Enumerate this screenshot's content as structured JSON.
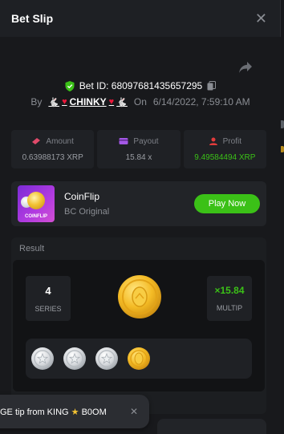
{
  "modal": {
    "title": "Bet Slip",
    "close_symbol": "✕"
  },
  "bet": {
    "id_label": "Bet ID: 68097681435657295",
    "by_label": "By",
    "user_name": "CHINKY",
    "on_label": "On",
    "datetime": "6/14/2022, 7:59:10 AM"
  },
  "stats": [
    {
      "label": "Amount",
      "value": "0.63988173 XRP",
      "icon": "amount-icon",
      "color": "#e04a6a"
    },
    {
      "label": "Payout",
      "value": "15.84 x",
      "icon": "payout-icon",
      "color": "#a458e6"
    },
    {
      "label": "Profit",
      "value": "9.49584494 XRP",
      "icon": "profit-icon",
      "color": "#e23c3c"
    }
  ],
  "game": {
    "name": "CoinFlip",
    "subtitle": "BC Original",
    "thumb_text": "COINFLIP",
    "play_label": "Play Now"
  },
  "result": {
    "title": "Result",
    "series_value": "4",
    "series_label": "SERIES",
    "multiplier_value": "×15.84",
    "multiplier_label": "MULTIP",
    "coins": [
      "silver",
      "silver",
      "silver",
      "gold"
    ]
  },
  "toast": {
    "text_before": "GE tip from KING",
    "star": "★",
    "text_after": "B0OM",
    "close_symbol": "✕"
  },
  "colors": {
    "accent_green": "#3bc117",
    "background": "#17181b",
    "panel": "#1e2024"
  }
}
